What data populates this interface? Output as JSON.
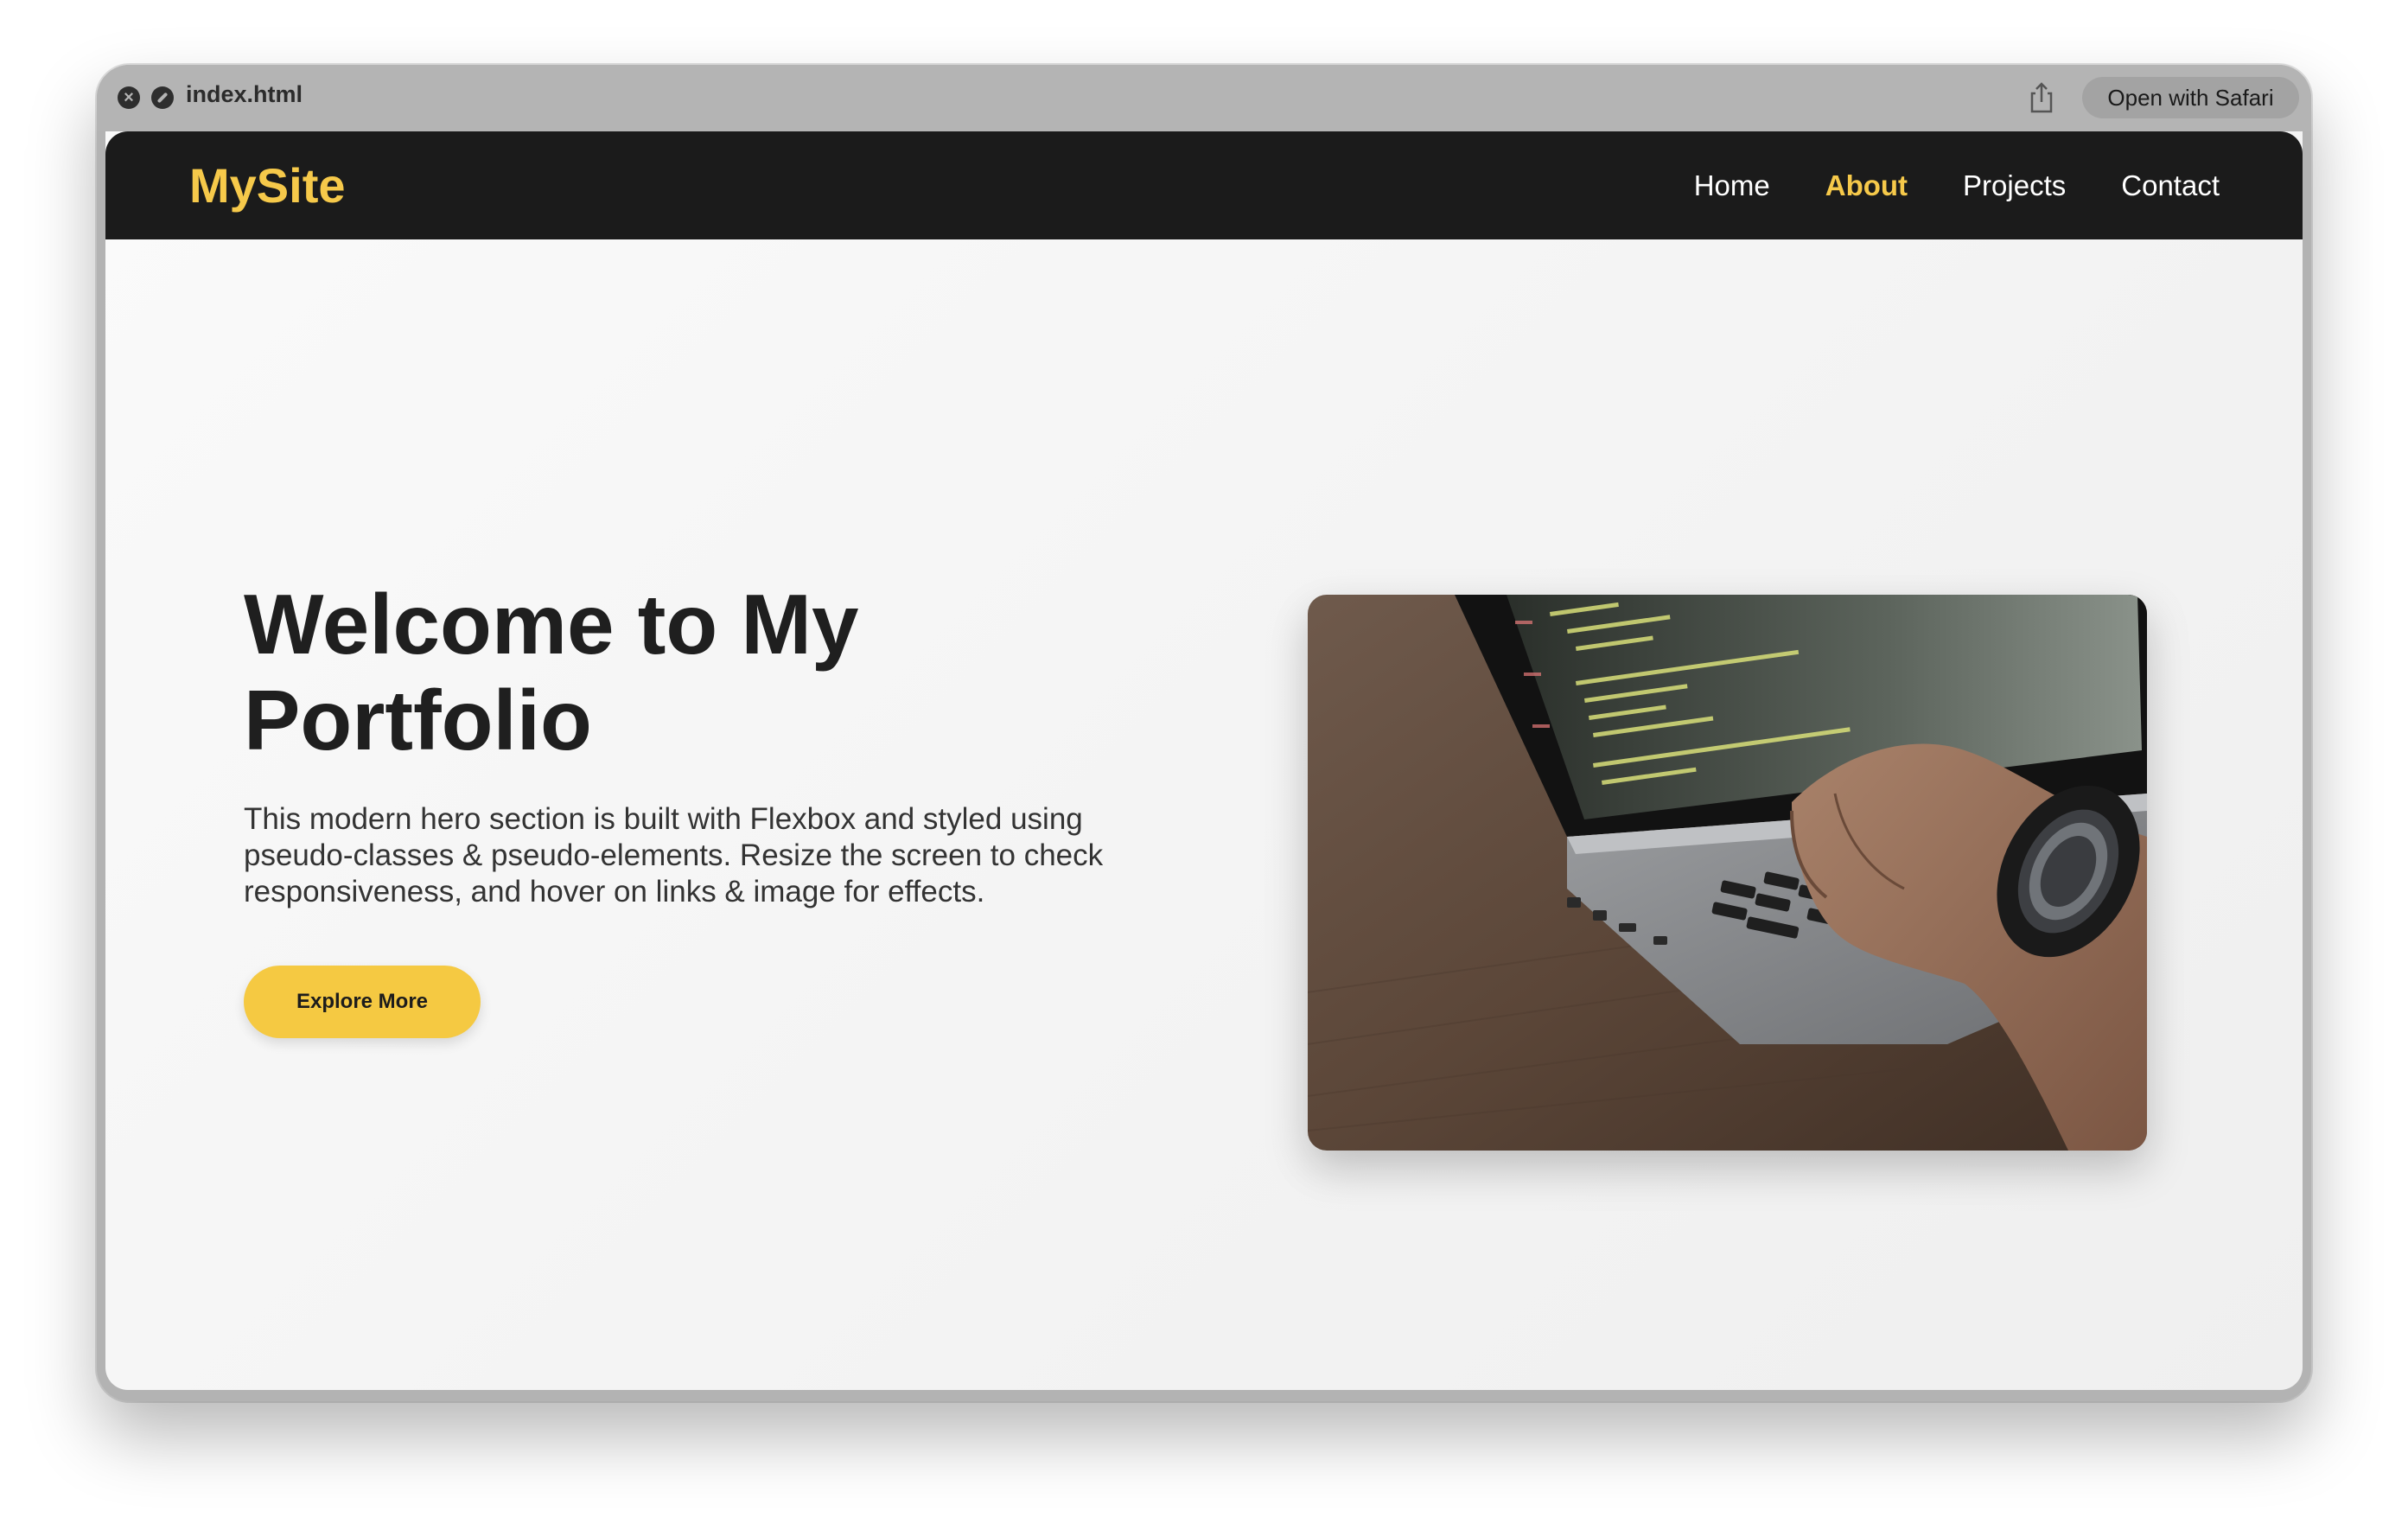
{
  "window": {
    "title": "index.html",
    "open_button": "Open with Safari",
    "icons": [
      "close-icon",
      "no-entry-icon",
      "share-icon"
    ]
  },
  "site": {
    "logo": "MySite",
    "nav": [
      {
        "label": "Home",
        "active": false
      },
      {
        "label": "About",
        "active": true
      },
      {
        "label": "Projects",
        "active": false
      },
      {
        "label": "Contact",
        "active": false
      }
    ]
  },
  "hero": {
    "title": "Welcome to My Portfolio",
    "description": "This modern hero section is built with Flexbox and styled using pseudo-classes & pseudo-elements. Resize the screen to check responsiveness, and hover on links & image for effects.",
    "button": "Explore More",
    "image_subject": "hands typing on a laptop showing code"
  },
  "colors": {
    "accent": "#f6c94a",
    "header_bg": "#1b1b1b",
    "titlebar_bg": "#b4b4b4"
  }
}
